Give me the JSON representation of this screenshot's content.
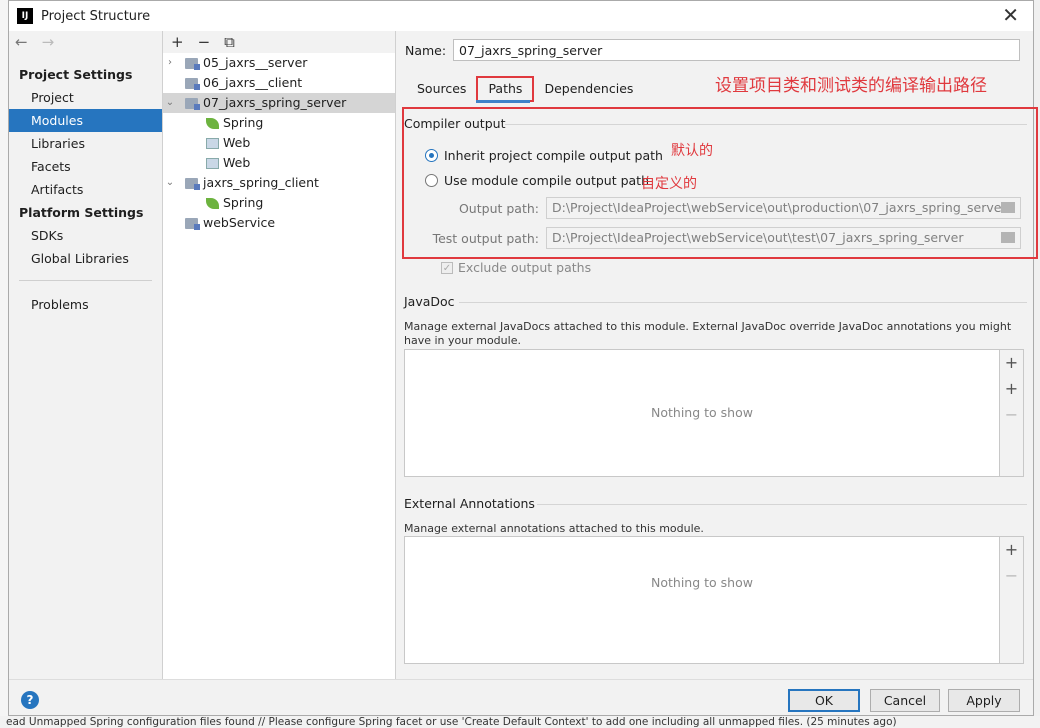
{
  "window": {
    "title": "Project Structure",
    "close": "✕"
  },
  "nav": {
    "back": "←",
    "forward": "→",
    "project_settings": "Project Settings",
    "project_items": [
      "Project",
      "Modules",
      "Libraries",
      "Facets",
      "Artifacts"
    ],
    "platform_settings": "Platform Settings",
    "platform_items": [
      "SDKs",
      "Global Libraries"
    ],
    "problems": "Problems"
  },
  "tree": {
    "toolbar": {
      "add": "+",
      "remove": "−",
      "copy": "⧉"
    },
    "rows": [
      {
        "label": "05_jaxrs__server",
        "arrow": "›"
      },
      {
        "label": "06_jaxrs__client",
        "arrow": ""
      },
      {
        "label": "07_jaxrs_spring_server",
        "arrow": "⌄"
      },
      {
        "label": "Spring"
      },
      {
        "label": "Web"
      },
      {
        "label": "Web"
      },
      {
        "label": "jaxrs_spring_client",
        "arrow": "⌄"
      },
      {
        "label": "Spring"
      },
      {
        "label": "webService"
      }
    ]
  },
  "module": {
    "name_label": "Name:",
    "name_value": "07_jaxrs_spring_server",
    "tabs": [
      "Sources",
      "Paths",
      "Dependencies"
    ],
    "active_tab": "Paths"
  },
  "annotations": {
    "title": "设置项目类和测试类的编译输出路径",
    "default": "默认的",
    "custom": "自定义的"
  },
  "compiler": {
    "title": "Compiler output",
    "inherit": "Inherit project compile output path",
    "use_module": "Use module compile output path",
    "output_label": "Output path:",
    "output_value": "D:\\Project\\IdeaProject\\webService\\out\\production\\07_jaxrs_spring_server",
    "test_label": "Test output path:",
    "test_value": "D:\\Project\\IdeaProject\\webService\\out\\test\\07_jaxrs_spring_server",
    "exclude": "Exclude output paths",
    "exclude_check": "✓"
  },
  "javadoc": {
    "title": "JavaDoc",
    "desc": "Manage external JavaDocs attached to this module. External JavaDoc override JavaDoc annotations you might have in your module.",
    "empty": "Nothing to show",
    "btn_add": "+",
    "btn_add_url": "+",
    "btn_remove": "−"
  },
  "annotations_section": {
    "title": "External Annotations",
    "desc": "Manage external annotations attached to this module.",
    "empty": "Nothing to show",
    "btn_add": "+",
    "btn_remove": "−"
  },
  "buttons": {
    "help": "?",
    "ok": "OK",
    "cancel": "Cancel",
    "apply": "Apply"
  },
  "background_status": "ead Unmapped Spring configuration files found // Please configure Spring facet or use 'Create Default Context' to add one including all unmapped files. (25 minutes ago)"
}
